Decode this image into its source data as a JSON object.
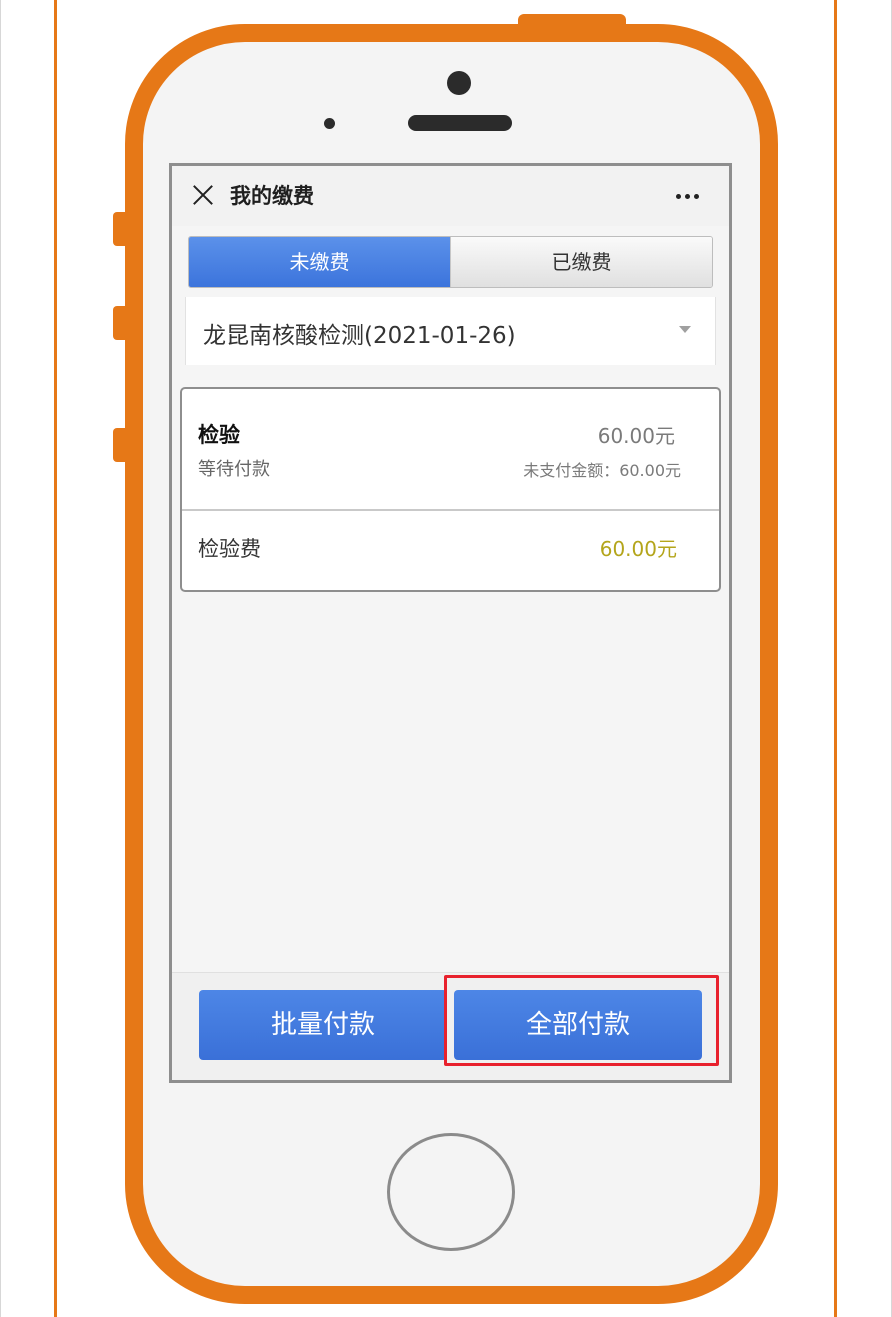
{
  "nav": {
    "title": "我的缴费",
    "close_icon": "close-icon",
    "more_icon": "more-icon"
  },
  "tabs": [
    {
      "label": "未缴费",
      "selected": true
    },
    {
      "label": "已缴费",
      "selected": false
    }
  ],
  "selector": {
    "value": "龙昆南核酸检测(2021-01-26)",
    "icon": "chevron-down-icon"
  },
  "bill": {
    "name": "检验",
    "status": "等待付款",
    "amount": "60.00元",
    "unpaid": "未支付金额：60.00元",
    "fee_name": "检验费",
    "fee_amount": "60.00元"
  },
  "actions": {
    "batch_pay": "批量付款",
    "all_pay": "全部付款"
  },
  "colors": {
    "frame": "#e67817",
    "accent": "#3c74dc",
    "highlight": "#e8212d",
    "fee_amount": "#b4a51b"
  }
}
